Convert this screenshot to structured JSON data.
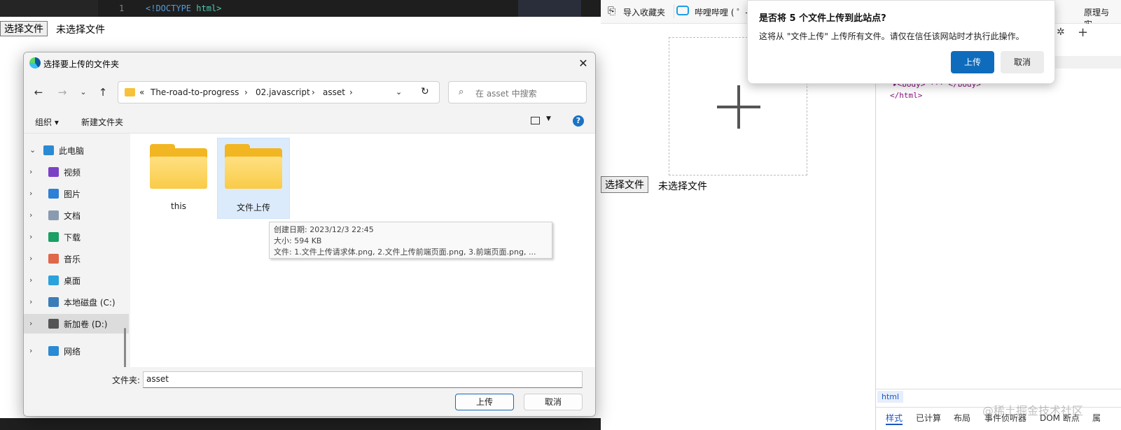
{
  "editor": {
    "line_number": "1",
    "code_prefix": "<!DOCTYPE ",
    "code_tag": "html>"
  },
  "left_page": {
    "choose_button": "选择文件",
    "no_file_text": "未选择文件"
  },
  "dialog": {
    "title": "选择要上传的文件夹",
    "breadcrumbs": [
      "«",
      "The-road-to-progress",
      "›",
      "02.javascript",
      "›",
      "asset",
      "›"
    ],
    "search_placeholder": "在 asset 中搜索",
    "toolbar": {
      "organize": "组织 ▾",
      "new_folder": "新建文件夹"
    },
    "tree": [
      {
        "label": "此电脑",
        "icon": "pc-icon",
        "chevron": "⌄",
        "color": "#2a8ad4"
      },
      {
        "label": "视频",
        "icon": "video-icon",
        "chevron": "›",
        "color": "#7b42c6"
      },
      {
        "label": "图片",
        "icon": "picture-icon",
        "chevron": "›",
        "color": "#2f7fd6"
      },
      {
        "label": "文档",
        "icon": "document-icon",
        "chevron": "›",
        "color": "#8a9bb0"
      },
      {
        "label": "下载",
        "icon": "download-icon",
        "chevron": "›",
        "color": "#1a9f64"
      },
      {
        "label": "音乐",
        "icon": "music-icon",
        "chevron": "›",
        "color": "#e0674b"
      },
      {
        "label": "桌面",
        "icon": "desktop-icon",
        "chevron": "›",
        "color": "#2aa2dc"
      },
      {
        "label": "本地磁盘 (C:)",
        "icon": "drive-c-icon",
        "chevron": "›",
        "color": "#3c7db8"
      },
      {
        "label": "新加卷 (D:)",
        "icon": "drive-d-icon",
        "chevron": "›",
        "color": "#555555"
      },
      {
        "label": "网络",
        "icon": "network-icon",
        "chevron": "›",
        "color": "#2a8ad4"
      }
    ],
    "folders": [
      {
        "name": "this"
      },
      {
        "name": "文件上传"
      }
    ],
    "tooltip": {
      "created": "创建日期: 2023/12/3 22:45",
      "size": "大小: 594 KB",
      "files": "文件: 1.文件上传请求体.png, 2.文件上传前端页面.png, 3.前端页面.png, ..."
    },
    "folder_label": "文件夹:",
    "folder_value": "asset",
    "upload_button": "上传",
    "cancel_button": "取消"
  },
  "favbar": {
    "import": "导入收藏夹",
    "bilibili": "哔哩哔哩 ( ゜-",
    "right_text": "原理与实..."
  },
  "right_page": {
    "choose_button": "选择文件",
    "no_file_text": "未选择文件",
    "plus": "+"
  },
  "permission": {
    "title": "是否将 5 个文件上传到此站点?",
    "body": "这将从 \"文件上传\" 上传所有文件。请仅在信任该网站时才执行此操作。",
    "upload": "上传",
    "cancel": "取消"
  },
  "devtools": {
    "body_line": "▸<body> ··· </body>",
    "html_close": "</html>",
    "crumb": "html",
    "tabs": [
      "样式",
      "已计算",
      "布局",
      "事件侦听器",
      "DOM 断点",
      "属"
    ],
    "watermark": "@稀土掘金技术社区"
  }
}
